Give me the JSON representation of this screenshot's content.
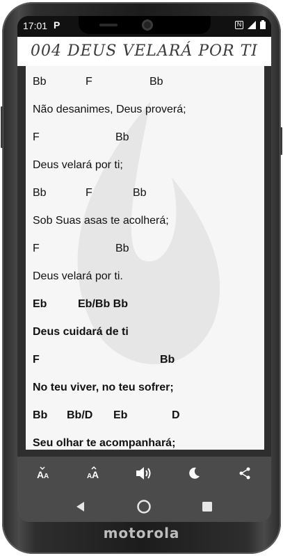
{
  "status": {
    "time": "17:01",
    "app_indicator": "P",
    "icons": [
      "nfc-icon",
      "signal-icon",
      "battery-icon"
    ],
    "nfc_glyph": "N"
  },
  "song": {
    "title": "004  DEUS VELARÁ POR TI"
  },
  "lyrics": [
    {
      "chords": [
        "Bb",
        "F",
        "Bb"
      ]
    },
    {
      "text": "Não desanimes, Deus proverá;"
    },
    {
      "chords": [
        "F",
        "Bb"
      ]
    },
    {
      "text": "Deus velará por ti;"
    },
    {
      "chords": [
        "Bb",
        "F",
        "Bb"
      ]
    },
    {
      "text": "Sob Suas asas te acolherá;"
    },
    {
      "chords": [
        "F",
        "Bb"
      ]
    },
    {
      "text": "Deus velará por ti."
    },
    {
      "chords": [
        "Eb",
        "Eb/Bb Bb"
      ]
    },
    {
      "text": "Deus cuidará de ti"
    },
    {
      "chords": [
        "F",
        "Bb"
      ]
    },
    {
      "text": "No teu viver, no teu sofrer;"
    },
    {
      "chords": [
        "Bb",
        "Bb/D",
        "Eb",
        "D"
      ]
    },
    {
      "text": "Seu olhar te acompanhará;"
    }
  ],
  "toolbar": {
    "buttons": [
      {
        "name": "font-decrease-button",
        "icon": "font-size-down-icon"
      },
      {
        "name": "font-increase-button",
        "icon": "font-size-up-icon"
      },
      {
        "name": "audio-button",
        "icon": "speaker-icon"
      },
      {
        "name": "night-mode-button",
        "icon": "moon-icon"
      },
      {
        "name": "share-button",
        "icon": "share-icon"
      }
    ]
  },
  "device": {
    "brand": "motorola"
  },
  "colors": {
    "toolbar_bg": "#4b4b4b",
    "lyrics_bg": "#f6f6f6",
    "title_color": "#3a3a3a"
  }
}
